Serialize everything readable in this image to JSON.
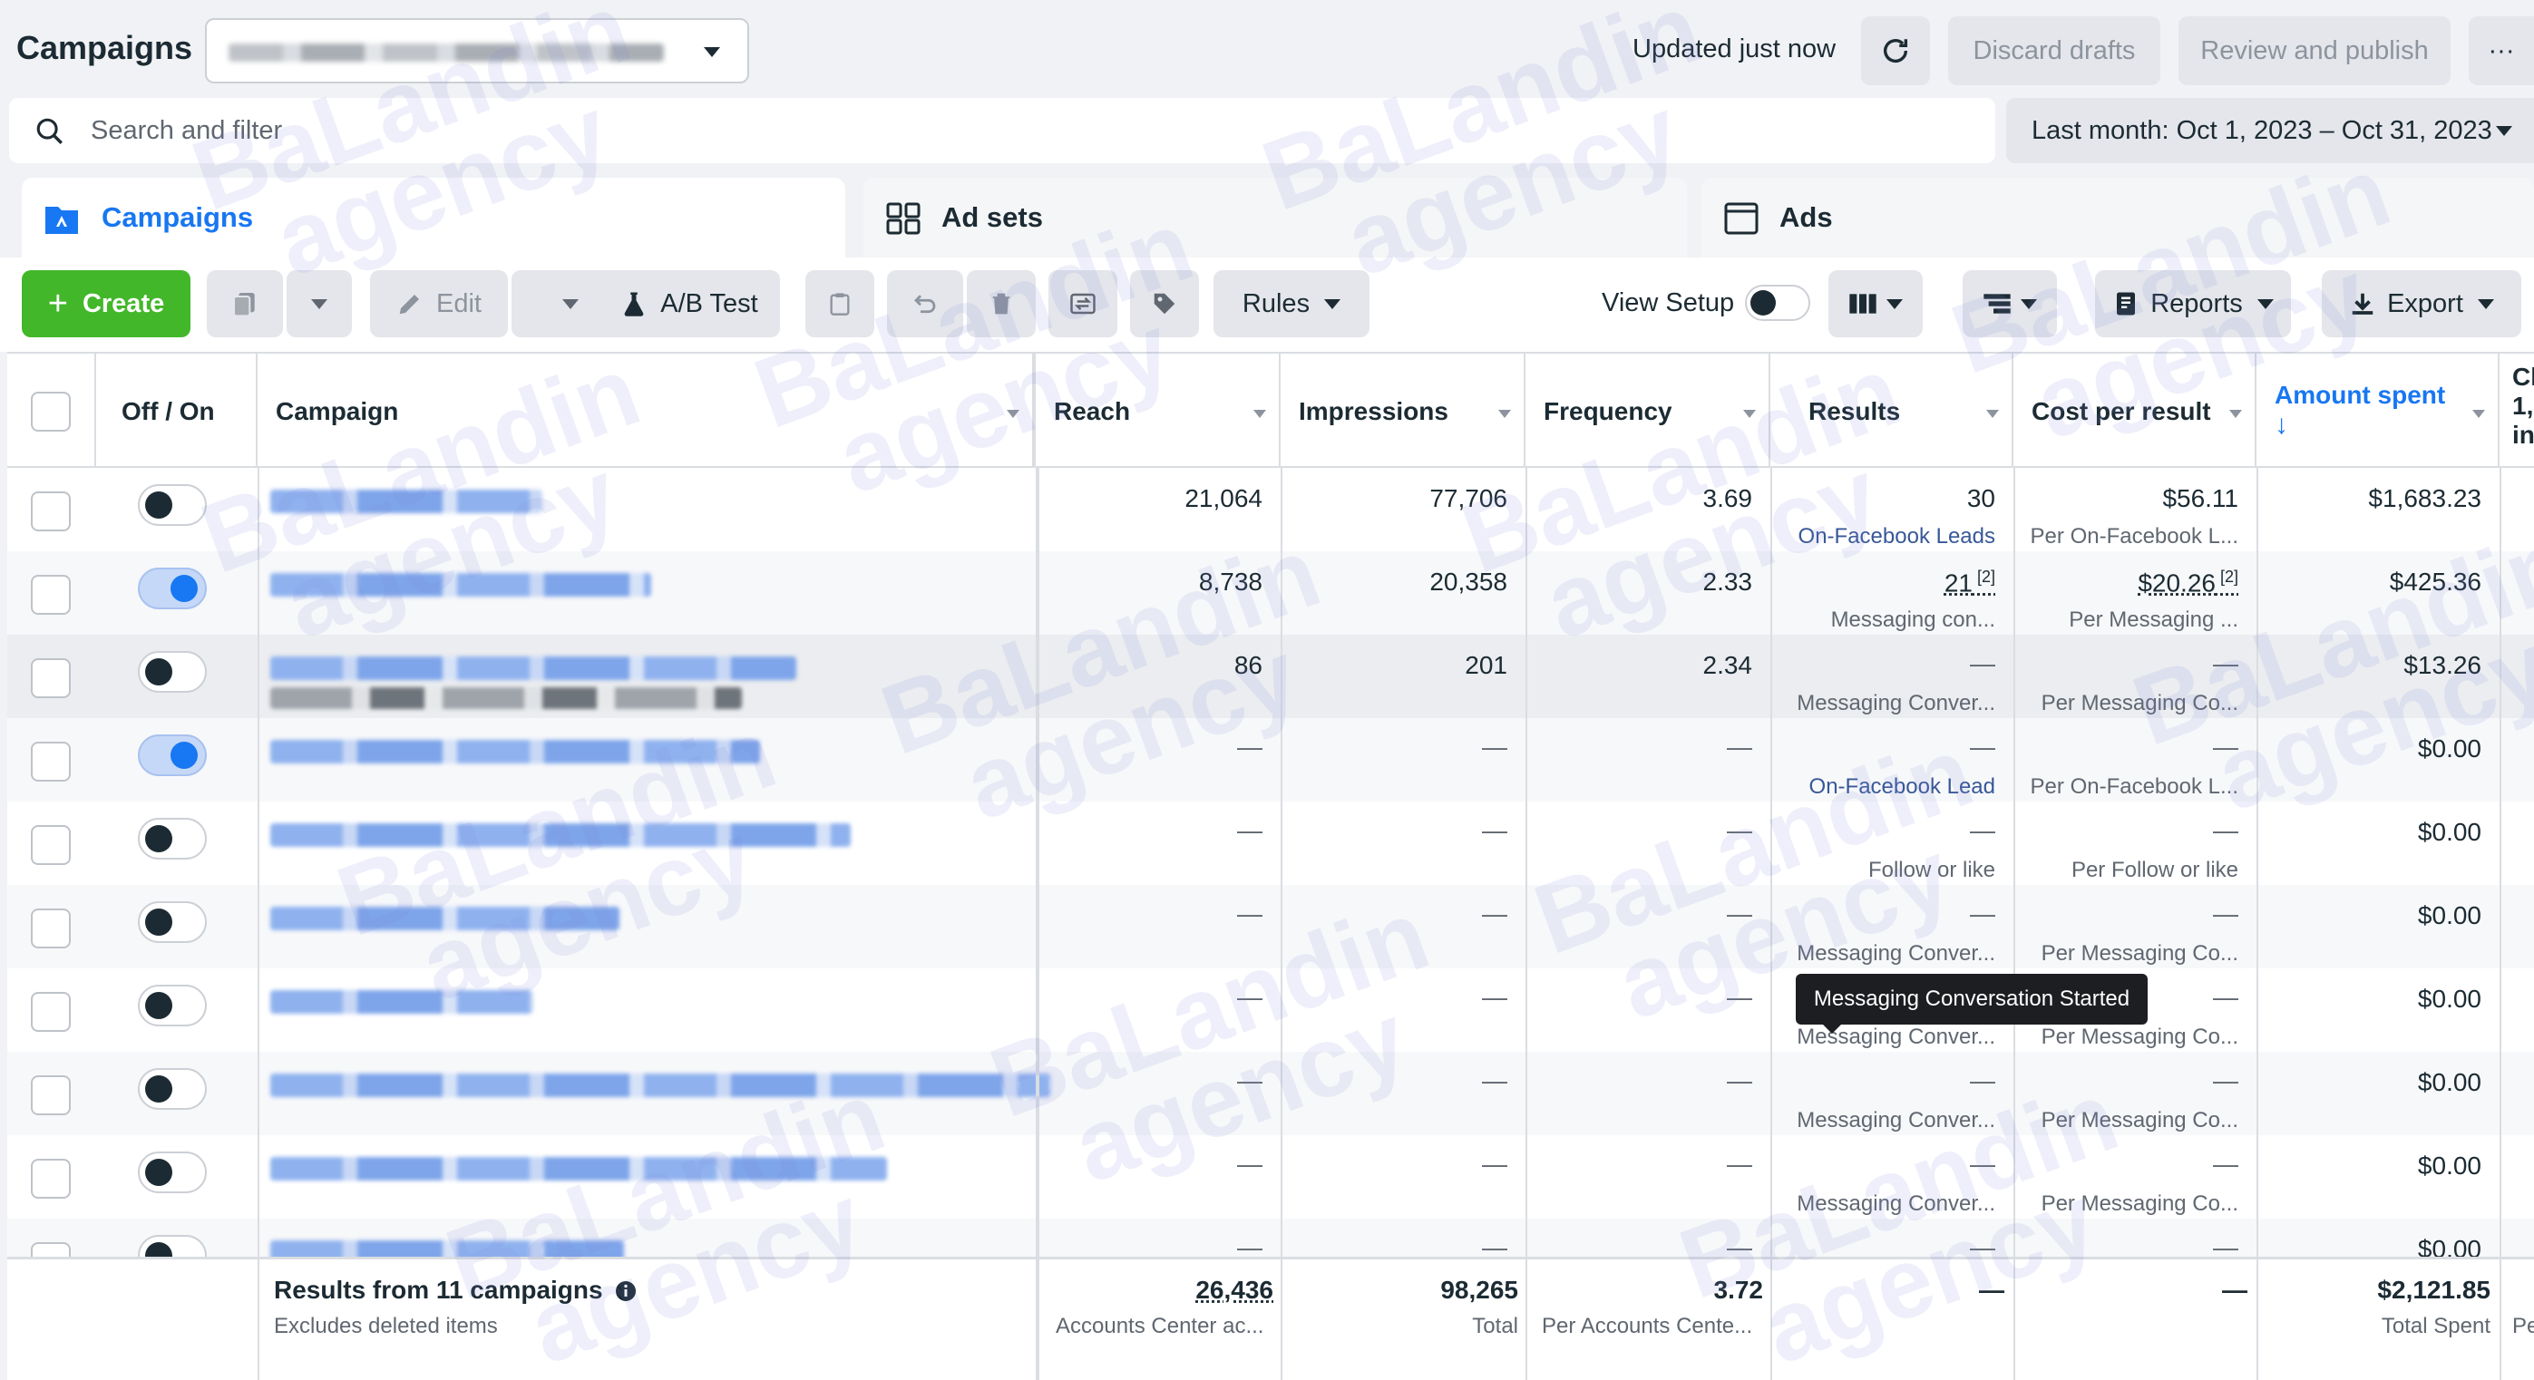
{
  "header": {
    "title": "Campaigns",
    "updated": "Updated just now",
    "discard": "Discard drafts",
    "review": "Review and publish",
    "more": "···"
  },
  "search": {
    "placeholder": "Search and filter"
  },
  "date_range": "Last month: Oct 1, 2023 – Oct 31, 2023",
  "tabs": [
    {
      "label": "Campaigns"
    },
    {
      "label": "Ad sets"
    },
    {
      "label": "Ads"
    }
  ],
  "toolbar": {
    "create": "Create",
    "edit": "Edit",
    "ab_test": "A/B Test",
    "rules": "Rules",
    "view_setup": "View Setup",
    "reports": "Reports",
    "export": "Export"
  },
  "columns": {
    "offon": "Off / On",
    "campaign": "Campaign",
    "reach": "Reach",
    "impressions": "Impressions",
    "frequency": "Frequency",
    "results": "Results",
    "cost_per_result": "Cost per result",
    "amount_spent": "Amount spent",
    "amount_spent_arrow": "↓",
    "last_col_1": "Cl",
    "last_col_2": "1,",
    "last_col_3": "in"
  },
  "rows": [
    {
      "on": false,
      "reach": "21,064",
      "impressions": "77,706",
      "frequency": "3.69",
      "results": "30",
      "results_sub": "On-Facebook Leads",
      "cpr": "$56.11",
      "cpr_sub": "Per On-Facebook L...",
      "spent": "$1,683.23"
    },
    {
      "on": true,
      "reach": "8,738",
      "impressions": "20,358",
      "frequency": "2.33",
      "results": "21",
      "results_note": "[2]",
      "results_sub": "Messaging con...",
      "cpr": "$20.26",
      "cpr_note": "[2]",
      "cpr_sub": "Per Messaging ...",
      "spent": "$425.36"
    },
    {
      "on": false,
      "reach": "86",
      "impressions": "201",
      "frequency": "2.34",
      "results": "—",
      "results_sub": "Messaging Conver...",
      "cpr": "—",
      "cpr_sub": "Per Messaging Co...",
      "spent": "$13.26"
    },
    {
      "on": true,
      "reach": "—",
      "impressions": "—",
      "frequency": "—",
      "results": "—",
      "results_sub": "On-Facebook Lead",
      "cpr": "—",
      "cpr_sub": "Per On-Facebook L...",
      "spent": "$0.00"
    },
    {
      "on": false,
      "reach": "—",
      "impressions": "—",
      "frequency": "—",
      "results": "—",
      "results_sub": "Follow or like",
      "cpr": "—",
      "cpr_sub": "Per Follow or like",
      "spent": "$0.00"
    },
    {
      "on": false,
      "reach": "—",
      "impressions": "—",
      "frequency": "—",
      "results": "—",
      "results_sub": "Messaging Conver...",
      "cpr": "—",
      "cpr_sub": "Per Messaging Co...",
      "spent": "$0.00"
    },
    {
      "on": false,
      "reach": "—",
      "impressions": "—",
      "frequency": "—",
      "results": "—",
      "results_sub": "Messaging Conver...",
      "cpr": "—",
      "cpr_sub": "Per Messaging Co...",
      "spent": "$0.00"
    },
    {
      "on": false,
      "reach": "—",
      "impressions": "—",
      "frequency": "—",
      "results": "—",
      "results_sub": "Messaging Conver...",
      "cpr": "—",
      "cpr_sub": "Per Messaging Co...",
      "spent": "$0.00"
    },
    {
      "on": false,
      "reach": "—",
      "impressions": "—",
      "frequency": "—",
      "results": "—",
      "results_sub": "Messaging Conver...",
      "cpr": "—",
      "cpr_sub": "Per Messaging Co...",
      "spent": "$0.00"
    },
    {
      "on": false,
      "reach": "—",
      "impressions": "—",
      "frequency": "—",
      "results": "—",
      "results_sub": "",
      "cpr": "—",
      "cpr_sub": "",
      "spent": "$0.00"
    }
  ],
  "tooltip": "Messaging Conversation Started",
  "footer": {
    "title": "Results from 11 campaigns",
    "subtitle": "Excludes deleted items",
    "reach": "26,436",
    "reach_sub": "Accounts Center ac...",
    "impressions": "98,265",
    "impressions_sub": "Total",
    "frequency": "3.72",
    "frequency_sub": "Per Accounts Cente...",
    "results": "—",
    "cpr": "—",
    "spent": "$2,121.85",
    "spent_sub": "Total Spent",
    "last_sub": "Pe"
  },
  "watermark": [
    "BaLandin",
    "agency"
  ],
  "colors": {
    "accent": "#1877f2",
    "create": "#42b72a",
    "link": "#385898"
  }
}
